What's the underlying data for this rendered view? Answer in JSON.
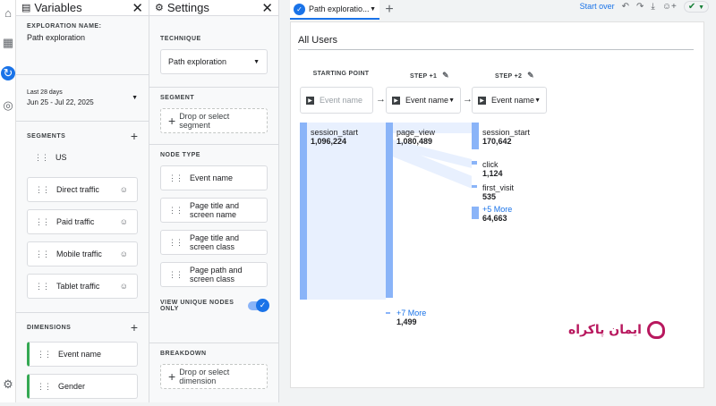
{
  "rail": {
    "icons": [
      "home-icon",
      "reports-icon",
      "explore-icon",
      "advertising-icon",
      "admin-gear-icon"
    ]
  },
  "variables": {
    "title": "Variables",
    "exploration_name_label": "EXPLORATION NAME:",
    "exploration_name": "Path exploration",
    "date_range_label": "Last 28 days",
    "date_range": "Jun 25 - Jul 22, 2025",
    "segments_label": "SEGMENTS",
    "segments": [
      "US",
      "Direct traffic",
      "Paid traffic",
      "Mobile traffic",
      "Tablet traffic"
    ],
    "dimensions_label": "DIMENSIONS",
    "dimensions": [
      "Event name",
      "Gender"
    ]
  },
  "settings": {
    "title": "Settings",
    "technique_label": "TECHNIQUE",
    "technique": "Path exploration",
    "segment_label": "SEGMENT",
    "segment_drop": "Drop or select segment",
    "node_type_label": "NODE TYPE",
    "node_types": [
      "Event name",
      "Page title and screen name",
      "Page title and screen class",
      "Page path and screen class"
    ],
    "view_unique_label": "VIEW UNIQUE NODES ONLY",
    "breakdown_label": "BREAKDOWN",
    "breakdown_drop": "Drop or select dimension"
  },
  "canvas": {
    "tab_label": "Path exploratio...",
    "start_over": "Start over",
    "segment_title": "All Users",
    "columns": [
      {
        "label": "STARTING POINT",
        "node": "Event name",
        "placeholder": true
      },
      {
        "label": "STEP +1",
        "node": "Event name",
        "placeholder": false
      },
      {
        "label": "STEP +2",
        "node": "Event name",
        "placeholder": false
      }
    ],
    "nodes": {
      "start": {
        "name": "session_start",
        "value": "1,096,224"
      },
      "step1": [
        {
          "name": "page_view",
          "value": "1,080,489"
        },
        {
          "name": "+7 More",
          "value": "1,499"
        }
      ],
      "step2": [
        {
          "name": "session_start",
          "value": "170,642"
        },
        {
          "name": "click",
          "value": "1,124"
        },
        {
          "name": "first_visit",
          "value": "535"
        },
        {
          "name": "+5 More",
          "value": "64,663"
        }
      ]
    }
  },
  "watermark": {
    "text": "ایمان پاکراه"
  },
  "colors": {
    "accent": "#1a73e8",
    "node_bar": "#8ab4f8",
    "flow": "#e8f0fe",
    "brand_watermark": "#b8185e"
  }
}
